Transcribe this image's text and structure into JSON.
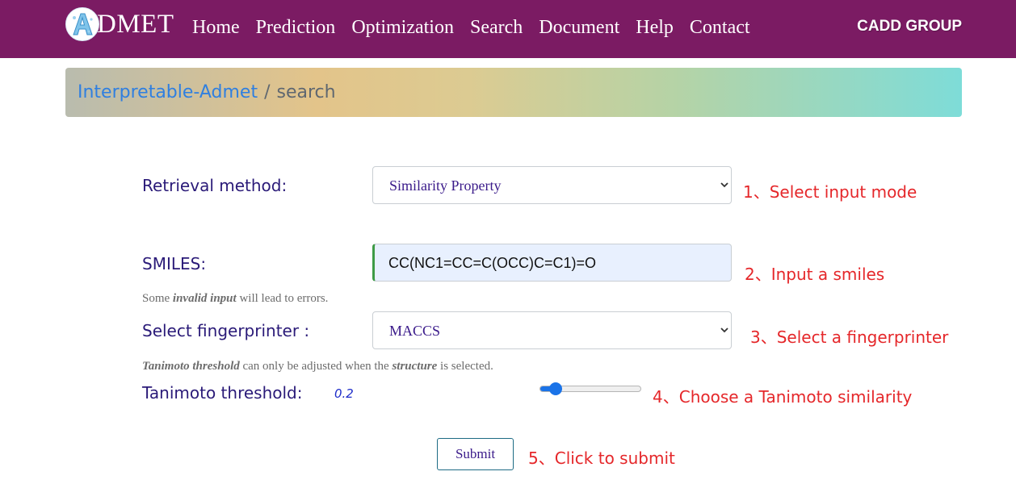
{
  "navbar": {
    "logo_text": "DMET",
    "links": [
      "Home",
      "Prediction",
      "Optimization",
      "Search",
      "Document",
      "Help",
      "Contact"
    ],
    "brand_right": "CADD GROUP",
    "background_color": "#7b1b63"
  },
  "breadcrumb": {
    "link": "Interpretable-Admet",
    "separator": "/",
    "current": "search"
  },
  "form": {
    "retrieval_method": {
      "label": "Retrieval method:",
      "selected": "Similarity Property",
      "annotation": "1、Select input mode"
    },
    "smiles": {
      "label": "SMILES:",
      "value": "CC(NC1=CC=C(OCC)C=C1)=O",
      "annotation": "2、Input a smiles",
      "help_prefix": "Some ",
      "help_emphasis": "invalid input",
      "help_suffix": " will lead to errors."
    },
    "fingerprinter": {
      "label": "Select fingerprinter :",
      "selected": "MACCS",
      "annotation": "3、Select a fingerprinter",
      "help_emphasis1": "Tanimoto threshold",
      "help_middle": " can only be adjusted when the ",
      "help_emphasis2": "structure",
      "help_suffix": " is selected."
    },
    "tanimoto": {
      "label": "Tanimoto threshold:",
      "value": "0.2",
      "slider_fraction": 0.15,
      "annotation": "4、Choose a Tanimoto similarity"
    },
    "submit": {
      "label": "Submit",
      "annotation": "5、Click to submit"
    }
  },
  "colors": {
    "label": "#2a1a78",
    "annotation": "#e5272a",
    "link": "#2f7fe0",
    "slider": "#1a73e8"
  }
}
